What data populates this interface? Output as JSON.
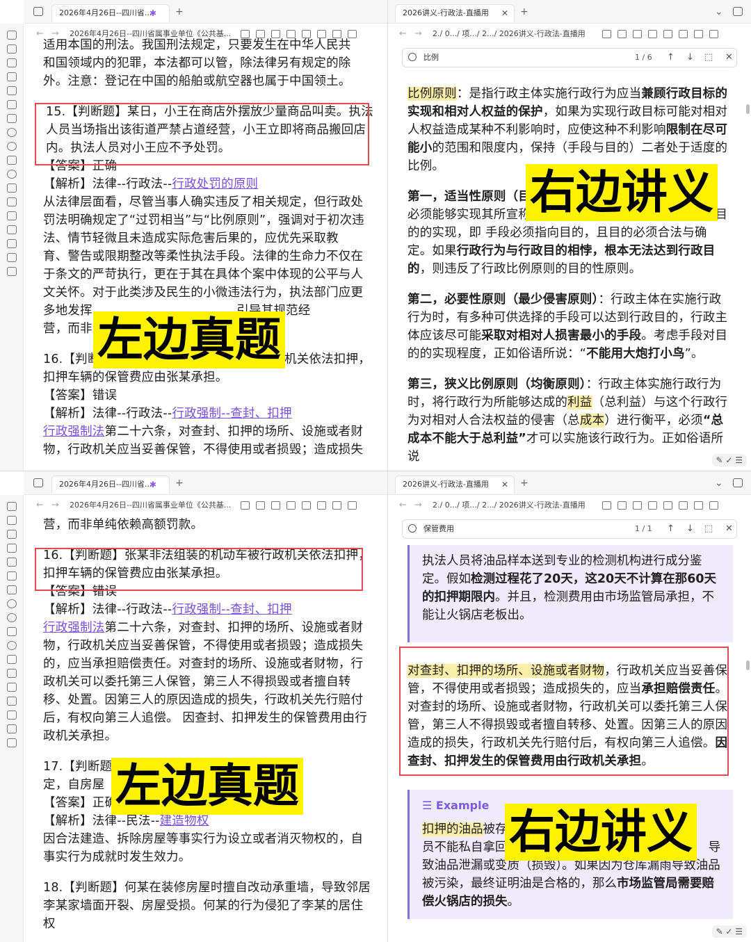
{
  "top": {
    "left_tab": "2026年4月26日--四川省...",
    "left_nav_title": "2026年4月26日--四川省属事业单位《公共基...",
    "right_tab": "2026讲义-行政法-直播用",
    "right_nav_title": "2./ 0.../ 项.../ 2.../ 2026讲义-行政法-直播用",
    "search": {
      "query": "比例",
      "count": "1 / 6"
    },
    "left_lines": [
      "适用本国的刑法。我国刑法规定，只要发生在中华人民共",
      "和国领域内的犯罪，本法都可以管，除法律另有规定的除",
      "外。注意：登记在中国的船舶或航空器也属于中国领土。"
    ],
    "q15": [
      "15.【判断题】某日，小王在商店外摆放少量商品叫卖。执法",
      "人员当场指出该街道严禁占道经营，小王立即将商品搬回店",
      "内。执法人员对小王应不予处罚。"
    ],
    "q15_answer": "【答案】正确",
    "q15_analysis_prefix": "【解析】法律--行政法--",
    "q15_analysis_link": "行政处罚的原则",
    "q15_body": [
      "从法律层面看，尽管当事人确实违反了相关规定，但行政处",
      "罚法明确规定了“过罚相当”与“比例原则”，强调对于初次违",
      "法、情节轻微且未造成实际危害后果的，应优先采取教",
      "育、警告或限期整改等柔性执法手段。法律的生命力不仅在",
      "于条文的严苛执行，更在于其在具体个案中体现的公平与人",
      "文关怀。对于此类涉及民生的小微违法行为，执法部门应更",
      "多地发挥                                    引导其规范经",
      "营，而非"
    ],
    "q16": [
      "16.【判断题】张某非法组装的机动车被行政机关依法扣押，",
      "扣押车辆的保管费应由张某承担。"
    ],
    "q16_answer": "【答案】错误",
    "q16_analysis_prefix": "【解析】法律--行政法--",
    "q16_analysis_link": "行政强制--查封、扣押",
    "q16_link2": "行政强制法",
    "q16_body_first": "第二十六条，对查封、扣押的场所、设施或者财",
    "q16_body_second": "物，行政机关应当妥善保管，不得使用或者损毁；造成损失",
    "right_p1": {
      "hl": "比例原则",
      "t1": "：是指行政主体实施行政行为应当",
      "b1": "兼顾行政目标的实现和相对人权益的保护",
      "t2": "，如果为实现行政目标可能对相对人权益造成某种不利影响时，应使这种不利影响",
      "b2": "限制在尽可能小",
      "t3": "的范围和限度内，保持（手段与目的）二者处于适度的比例。"
    },
    "right_p2": {
      "b1": "第一，适当性原则（目",
      "t1": "必须能够实现其所宣称的行政目的，至少是有助于该行政目的的实现，即 手段必须指向目的，且目的必须合法与确定。如果",
      "b2": "行政行为与行政目的相悖，根本无法达到行政目的",
      "t2": "，则违反了行政比例原则的目的性原则。"
    },
    "right_p3": {
      "b1": "第二，必要性原则（最少侵害原则）",
      "t1": "：行政主体在实施行政行为时，有多种可供选择的手段可以达到行政目的，行政主体应该尽可能",
      "b2": "采取对相对人损害最小的手段",
      "t2": "。考虑手段对目的的实现程度，正如俗语所说：“",
      "b3": "不能用大炮打小鸟",
      "t3": "”。"
    },
    "right_p4": {
      "b1": "第三，狭义比例原则（均衡原则）",
      "t1": "：行政主体实施行政行为时，将行政行为所能够达成的",
      "hl1": "利益",
      "t2": "（总利益）与这个行政行为对相对人合法权益的侵害（总",
      "hl2": "成本",
      "t3": "）进行衡平，必须",
      "b2": "“总成本不能大于总利益”",
      "t4": "才可以实施该行政行为。正如俗语所说"
    },
    "tag_left": "左边真题",
    "tag_right": "右边讲义"
  },
  "bottom": {
    "left_tab": "2026年4月26日--四川省...",
    "left_nav_title": "2026年4月26日--四川省属事业单位《公共基...",
    "right_tab": "2026讲义-行政法-直播用",
    "right_nav_title": "2./ 0.../ 项.../ 2.../ 2026讲义-行政法-直播用",
    "search": {
      "query": "保管费用",
      "count": "1 / 1"
    },
    "left_first": "营，而非单纯依赖高额罚款。",
    "q16": [
      "16.【判断题】张某非法组装的机动车被行政机关依法扣押，",
      "扣押车辆的保管费应由张某承担。"
    ],
    "q16_answer": "【答案】错误",
    "q16_analysis_prefix": "【解析】法律--行政法--",
    "q16_analysis_link": "行政强制--查封、扣押",
    "q16_link2": "行政强制法",
    "q16_body_first": "第二十六条，对查封、扣押的场所、设施或者财",
    "q16_body": [
      "物，行政机关应当妥善保管，不得使用或者损毁；造成损失",
      "的，应当承担赔偿责任。对查封的场所、设施或者财物，行",
      "政机关可以委托第三人保管，第三人不得损毁或者擅自转",
      "移、处置。因第三人的原因造成的损失，行政机关先行赔付",
      "后，有权向第三人追偿。 因查封、扣押发生的保管费用由行",
      "政机关承担。"
    ],
    "q17": [
      "17.【判断题                                      法律规",
      "定，自房屋"
    ],
    "q17_answer": "【答案】正确",
    "q17_analysis_prefix": "【解析】法律--民法--",
    "q17_analysis_link": "建造物权",
    "q17_body": [
      "因合法建造、拆除房屋等事实行为设立或者消灭物权的，自",
      "事实行为成就时发生效力。"
    ],
    "q18": [
      "18.【判断题】何某在装修房屋时擅自改动承重墙，导致邻居",
      "李某家墙面开裂、房屋受损。何某的行为侵犯了李某的居住",
      "权"
    ],
    "callout1": {
      "t1": "执法人员将油品样本送到专业的检测机构进行成分鉴定。假如",
      "b1": "检测过程花了20天，这20天不计算在那60天的扣押期限内",
      "t2": "。并且，检测费用由市场监管局承担，不能让火锅店老板出。"
    },
    "right_p": {
      "hl": "对查封、扣押的场所、设施或者财物",
      "t1": "，行政机关应当妥善保管，不得使用或者损毁；造成损失的，应当",
      "b1": "承担赔偿责任",
      "t2": "。对查封的场所、设施或者财物，行政机关可以委托第三人保管，第三人不得损毁或者擅自转移、处置。因第三人的原因造成的损失，行政机关先行赔付后，有权向第三人追偿。",
      "b2": "因查封、扣押发生的保管费用由行政机关承担",
      "t3": "。"
    },
    "callout2": {
      "title": "Example",
      "hl": "扣押的油品",
      "t1": "被存",
      "t2": "员不能私自拿回                                                    导致油品泄漏或变质（损毁）。如果因为仓库漏雨导致油品被污染，最终证明油是合格的，那么",
      "b1": "市场监管局需要赔偿火锅店的损失",
      "t3": "。"
    },
    "tag_left": "左边真题",
    "tag_right": "右边讲义"
  }
}
